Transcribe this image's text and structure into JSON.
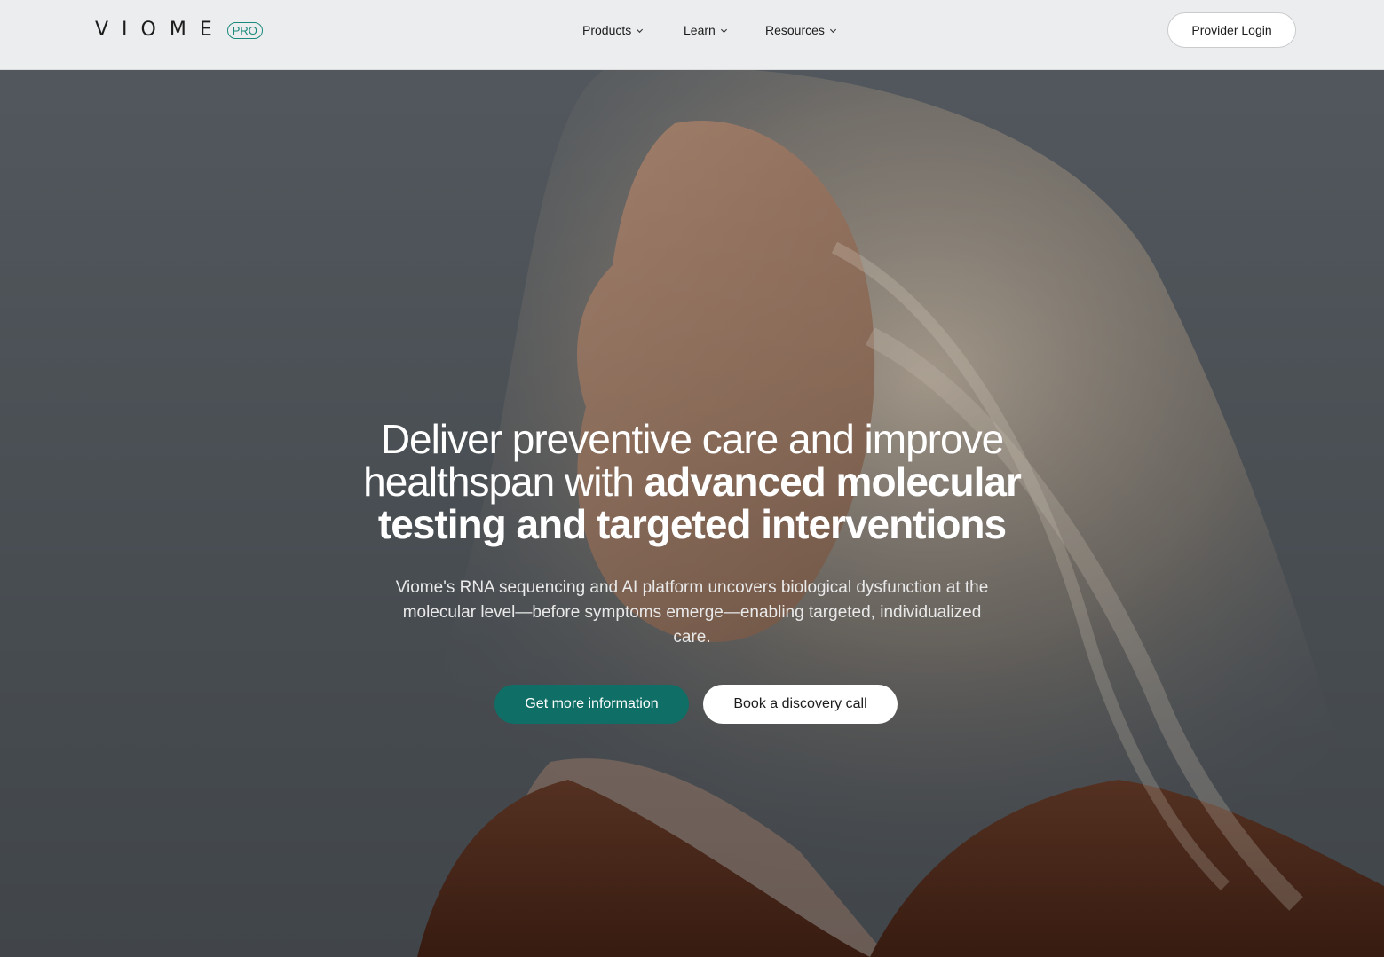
{
  "header": {
    "logo_text": "VIOME",
    "logo_badge": "PRO",
    "nav": [
      {
        "label": "Products",
        "icon": "chevron-down-icon"
      },
      {
        "label": "Learn",
        "icon": "chevron-down-icon"
      },
      {
        "label": "Resources",
        "icon": "chevron-down-icon"
      }
    ],
    "login_label": "Provider Login"
  },
  "hero": {
    "headline_regular": "Deliver preventive care and improve healthspan with ",
    "headline_bold": "advanced molecular testing and targeted interventions",
    "subtitle": "Viome's RNA sequencing and AI platform uncovers biological dysfunction at the molecular level—before symptoms emerge—enabling targeted, individualized care.",
    "primary_cta": "Get more information",
    "secondary_cta": "Book a discovery call"
  },
  "colors": {
    "brand_teal": "#0f6e65",
    "logo_teal": "#1a8a7d",
    "header_bg": "#ecedee"
  }
}
